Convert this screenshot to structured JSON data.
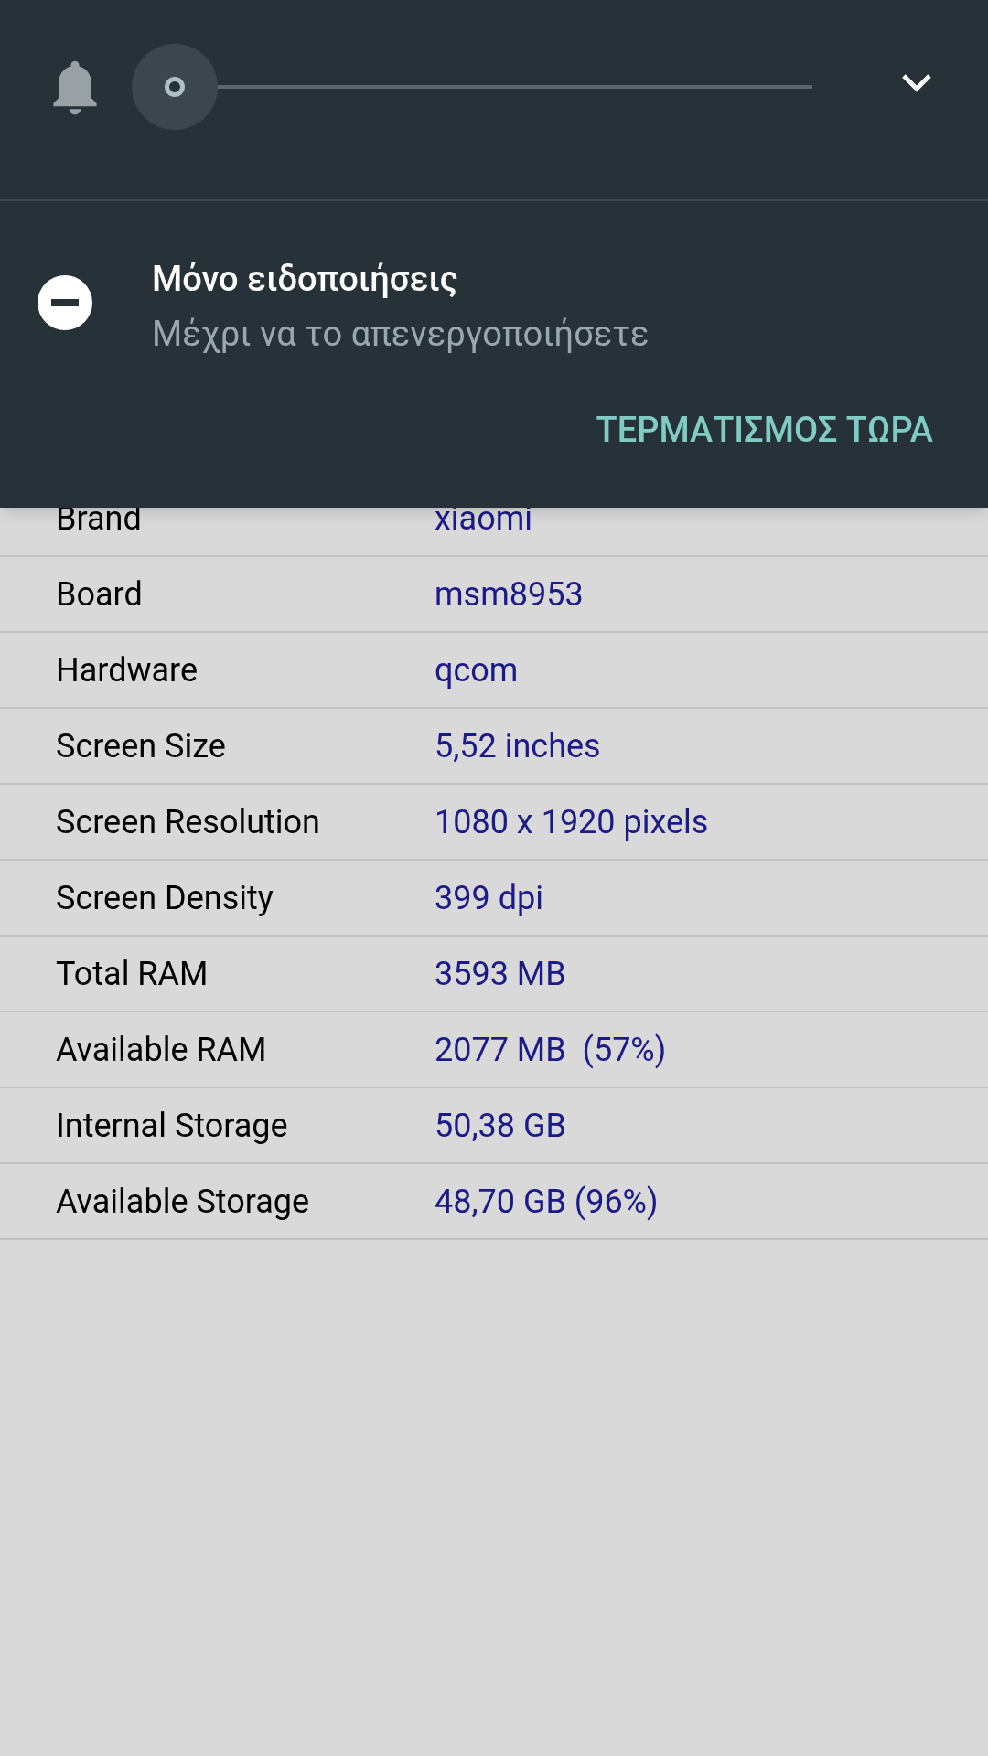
{
  "volume_panel": {
    "expanded": false
  },
  "dnd": {
    "title": "Μόνο ειδοποιήσεις",
    "subtitle": "Μέχρι να το απενεργοποιήσετε",
    "action": "ΤΕΡΜΑΤΙΣΜΟΣ ΤΩΡΑ"
  },
  "rows": [
    {
      "label": "Brand",
      "value": "xiaomi"
    },
    {
      "label": "Board",
      "value": "msm8953"
    },
    {
      "label": "Hardware",
      "value": "qcom"
    },
    {
      "label": "Screen Size",
      "value": "5,52 inches"
    },
    {
      "label": "Screen Resolution",
      "value": "1080 x 1920 pixels"
    },
    {
      "label": "Screen Density",
      "value": "399 dpi"
    },
    {
      "label": "Total RAM",
      "value": "3593 MB"
    },
    {
      "label": "Available RAM",
      "value": "2077 MB  (57%)"
    },
    {
      "label": "Internal Storage",
      "value": "50,38 GB"
    },
    {
      "label": "Available Storage",
      "value": "48,70 GB (96%)"
    }
  ]
}
